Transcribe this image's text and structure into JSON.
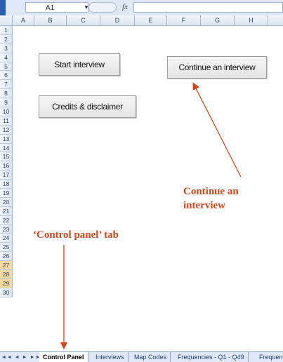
{
  "formula_bar": {
    "name_box": "A1",
    "fx": "fx",
    "oval": "●"
  },
  "columns": [
    "A",
    "B",
    "C",
    "D",
    "E",
    "F",
    "G",
    "H"
  ],
  "rows": [
    "1",
    "2",
    "3",
    "4",
    "5",
    "6",
    "7",
    "8",
    "9",
    "10",
    "11",
    "12",
    "13",
    "14",
    "15",
    "16",
    "17",
    "18",
    "19",
    "20",
    "21",
    "22",
    "23",
    "24",
    "25",
    "26",
    "27",
    "28",
    "29",
    "30"
  ],
  "buttons": {
    "start": "Start interview",
    "continue": "Continue an interview",
    "credits": "Credits & disclaimer"
  },
  "annotations": {
    "continue_line1": "Continue an",
    "continue_line2": "interview",
    "control_tab": "‘Control panel’ tab"
  },
  "tabs": {
    "nav": "◄◄ ◄ ► ►►",
    "items": [
      "Control Panel",
      "Interviews",
      "Map Codes",
      "Frequencies - Q1 - Q49",
      "Frequen"
    ]
  },
  "colors": {
    "annotation": "#d2461c",
    "background": "#0b3a8c"
  }
}
